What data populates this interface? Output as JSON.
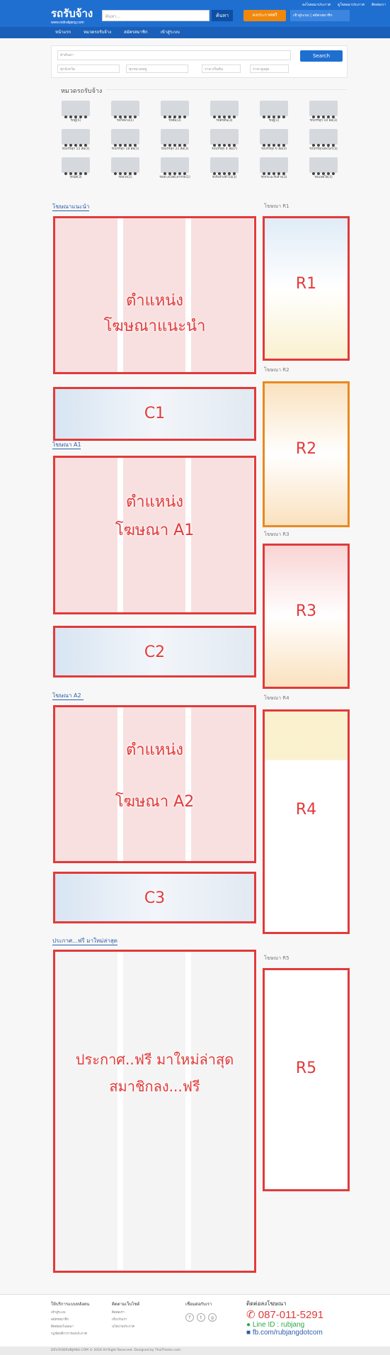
{
  "header": {
    "logo_text": "รถรับจ้าง",
    "logo_sub": "www.rodrubjang.com",
    "search_placeholder": "ค้นหา...",
    "search_label": "ค้นหา",
    "post_label": "ลงประกาศฟรี",
    "user_label": "เข้าสู่ระบบ | สมัครสมาชิก",
    "top_links": [
      "ลงโฆษณาประกาศ",
      "ดูโฆษณาประกาศ",
      "ติดต่อเรา"
    ]
  },
  "nav": {
    "items": [
      "หน้าแรก",
      "หมวดรถรับจ้าง",
      "สมัครสมาชิก",
      "เข้าสู่ระบบ"
    ]
  },
  "filter": {
    "keyword_placeholder": "คำค้นหา",
    "type_placeholder": "ทุกจังหวัด",
    "category_placeholder": "ทุกหมวดหมู่",
    "price_min": "ราคาเริ่มต้น",
    "price_max": "ราคาสูงสุด",
    "search_label": "Search"
  },
  "categories": {
    "title": "หมวดรถรับจ้าง",
    "items": [
      {
        "label": "รถตู้(5)"
      },
      {
        "label": "รถกึ่งพ่วง(1)"
      },
      {
        "label": "รถดั้ม(3)"
      },
      {
        "label": "รถตักดิน(3)"
      },
      {
        "label": "รถตู้(1)"
      },
      {
        "label": "รถบรรทุก 10 ล้อ(3)"
      },
      {
        "label": "รถบรรทุก 12 ล้อ(3)"
      },
      {
        "label": "รถบรรทุก 18 ล้อ(1)"
      },
      {
        "label": "รถบรรทุก 22 ล้อ(3)"
      },
      {
        "label": "รถบรรทุก 4 ล้อ(7)"
      },
      {
        "label": "รถบรรทุก 6 ล้อ(3)"
      },
      {
        "label": "รถบรรทุกเฮลโลว์(3)"
      },
      {
        "label": "รถบัส(3)"
      },
      {
        "label": "รถพ่วง(1)"
      },
      {
        "label": "รถยก,สไลด์,ลากรถ(1)"
      },
      {
        "label": "รถรับจ้างทั่วไป(3)"
      },
      {
        "label": "รถกระบะรับจ้าง(3)"
      },
      {
        "label": "รถแบคโฮ(3)"
      }
    ]
  },
  "sections": {
    "recommended": "โฆษณาแนะนำ",
    "a1": "โฆษณา A1",
    "a2": "โฆษณา A2",
    "latest": "ประกาศ...ฟรี มาใหม่ล่าสุด",
    "r1": "โฆษณา R1",
    "r2": "โฆษณา R2",
    "r3": "โฆษณา R3",
    "r4": "โฆษณา R4",
    "r5": "โฆษณา R5"
  },
  "ad_labels": {
    "recommended_line1": "ตำแหน่ง",
    "recommended_line2": "โฆษณาแนะนำ",
    "a1_line1": "ตำแหน่ง",
    "a1_line2": "โฆษณา A1",
    "a2_line1": "ตำแหน่ง",
    "a2_line2": "โฆษณา A2",
    "latest_line1": "ประกาศ..ฟรี มาใหม่ล่าสุด",
    "latest_line2": "สมาชิกลง...ฟรี",
    "c1": "C1",
    "c2": "C2",
    "c3": "C3",
    "r1": "R1",
    "r2": "R2",
    "r3": "R3",
    "r4": "R4",
    "r5": "R5"
  },
  "footer": {
    "col1_title": "ให้บริการแบบหลังคน",
    "col1_items": [
      "เข้าสู่ระบบ",
      "สมัครสมาชิก",
      "ติดต่อลงโฆษณา",
      "กฎข้อกติกาการลงประกาศ"
    ],
    "col2_title": "ติดตามเว็บไซต์",
    "col2_items": [
      "ติดต่อเรา",
      "เกี่ยวกับเรา",
      "นโยบายประกาศ"
    ],
    "col3_title": "เชื่อมต่อกับเรา",
    "contact_title": "ติดต่อลงโฆษณา",
    "phone": "087-011-5291",
    "line_id": "Line ID : rubjang",
    "facebook": "fb.com/rubjangdotcom",
    "copyright": "DEV.RODRUBJANG.COM © 2016 All Right Reserved. Designed by ThaiTheme.com"
  }
}
